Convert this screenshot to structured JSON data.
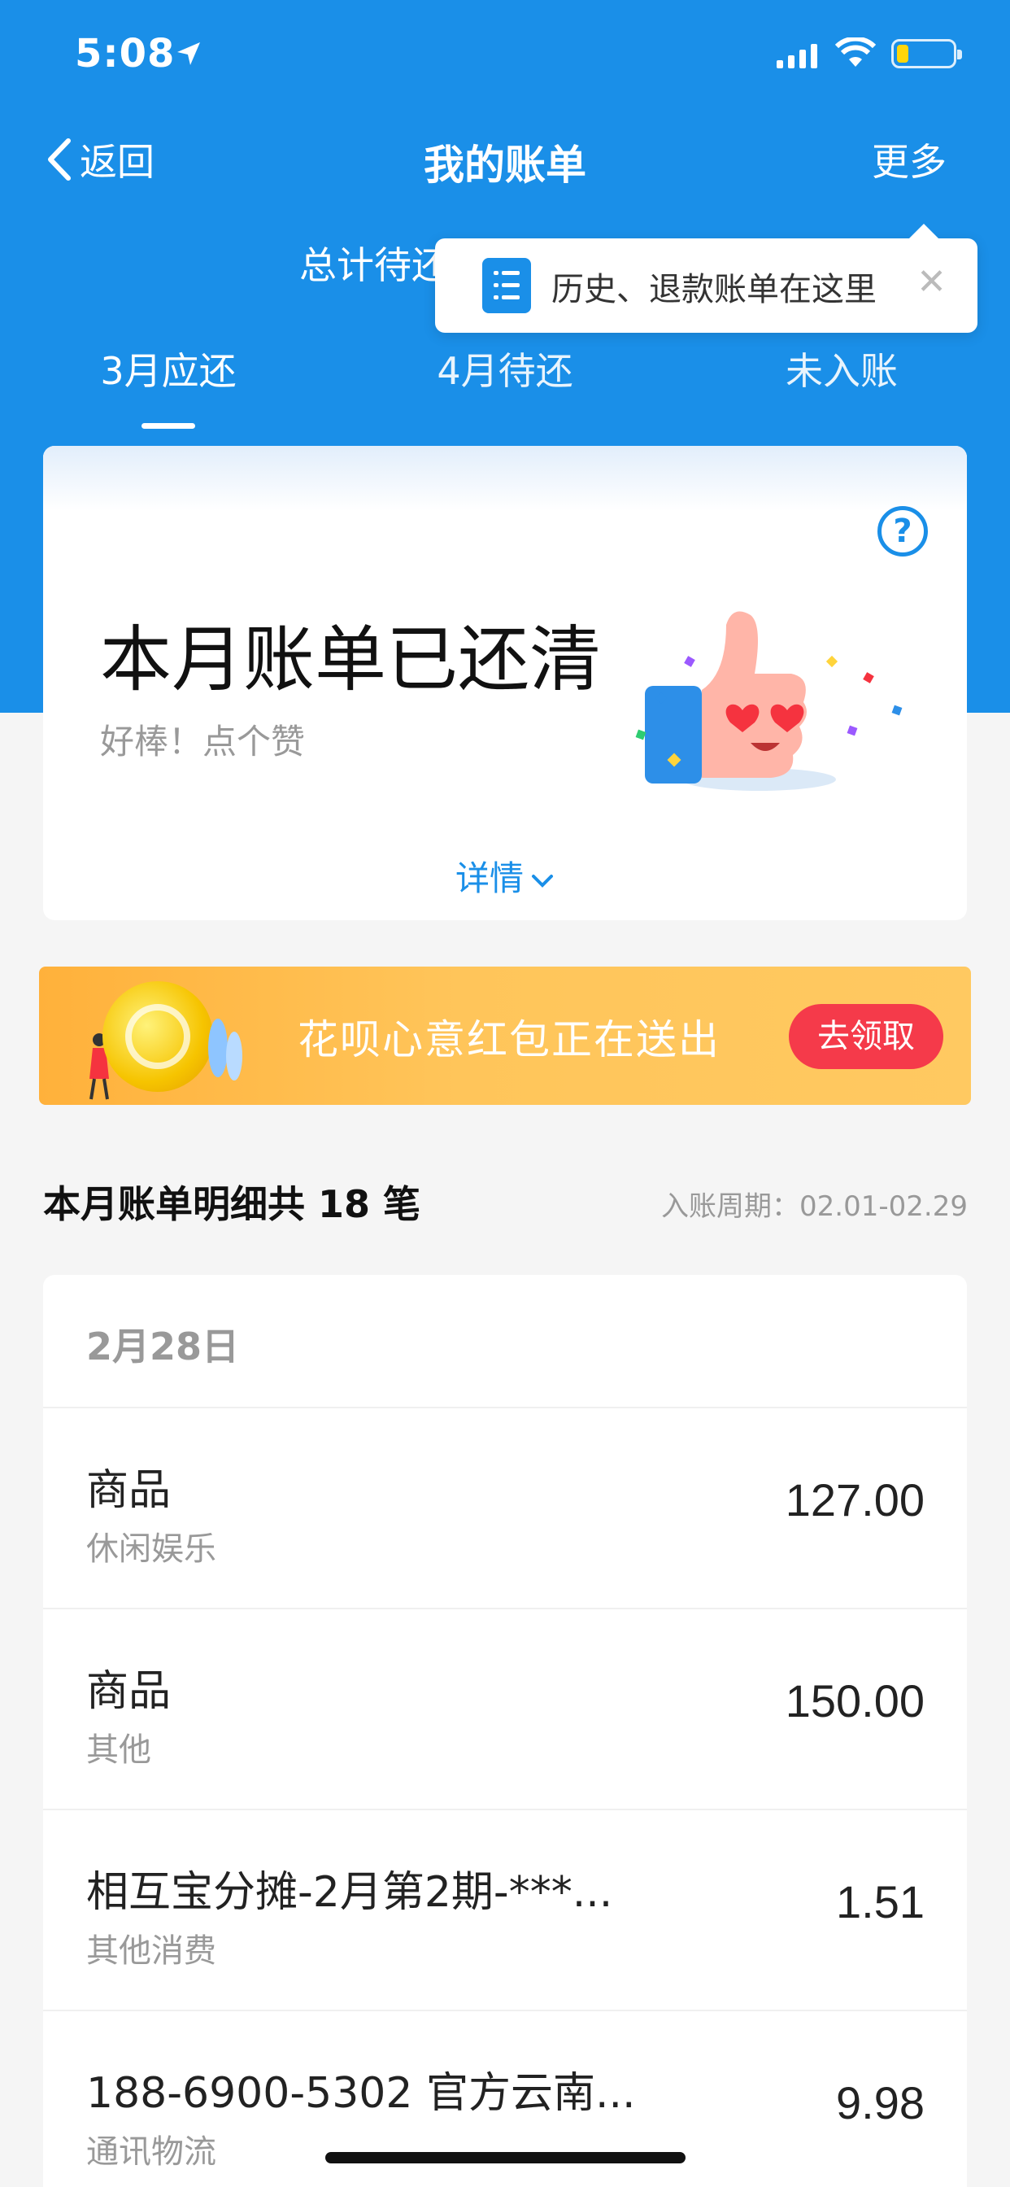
{
  "status_bar": {
    "time": "5:08"
  },
  "nav": {
    "back_label": "返回",
    "title": "我的账单",
    "more_label": "更多"
  },
  "total_label": "总计待还",
  "tooltip": {
    "text": "历史、退款账单在这里",
    "close": "✕"
  },
  "tabs": [
    {
      "label": "3月应还",
      "active": true
    },
    {
      "label": "4月待还",
      "active": false
    },
    {
      "label": "未入账",
      "active": false
    }
  ],
  "status_card": {
    "title": "本月账单已还清",
    "subtitle": "好棒！点个赞",
    "details_label": "详情"
  },
  "banner": {
    "text": "花呗心意红包正在送出",
    "button_label": "去领取"
  },
  "section": {
    "title": "本月账单明细共 18 笔",
    "period": "入账周期：02.01-02.29"
  },
  "list": {
    "date": "2月28日",
    "items": [
      {
        "name": "商品",
        "category": "休闲娱乐",
        "amount": "127.00"
      },
      {
        "name": "商品",
        "category": "其他",
        "amount": "150.00"
      },
      {
        "name": "相互宝分摊-2月第2期-***...",
        "category": "其他消费",
        "amount": "1.51"
      },
      {
        "name": "188-6900-5302 官方云南...",
        "category": "通讯物流",
        "amount": "9.98"
      }
    ]
  },
  "colors": {
    "primary_blue": "#1a8fe8",
    "banner_orange": "#ffc55a",
    "button_red": "#f53a4a"
  }
}
